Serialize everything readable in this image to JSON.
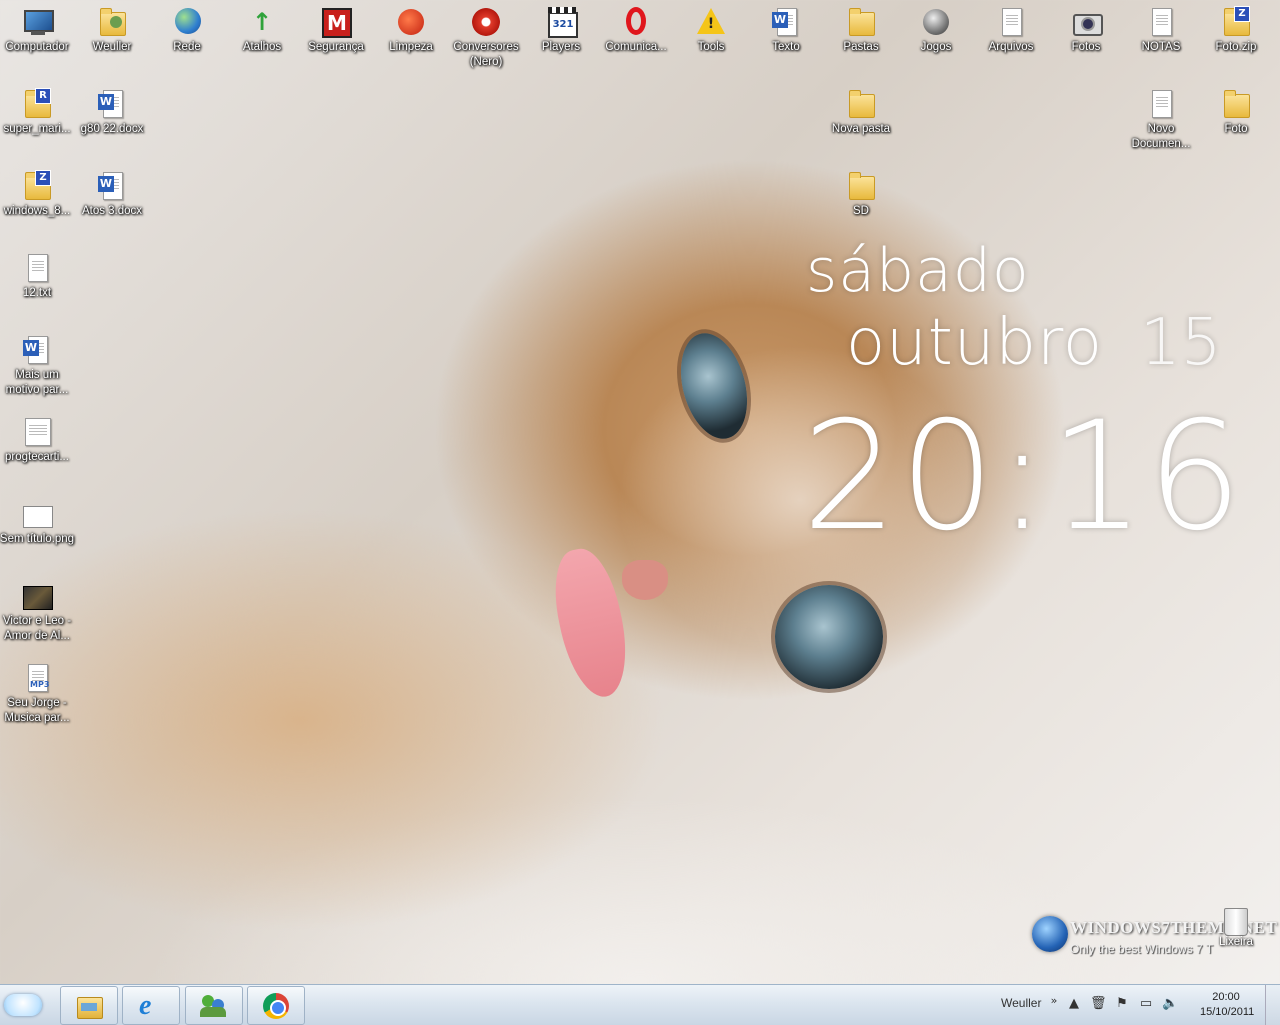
{
  "desktop": {
    "top_row": [
      {
        "label": "Computador",
        "icon": "computer-icon"
      },
      {
        "label": "Weuller",
        "icon": "user-folder-icon"
      },
      {
        "label": "Rede",
        "icon": "network-icon"
      },
      {
        "label": "Atalhos",
        "icon": "green-arrow-icon"
      },
      {
        "label": "Segurança",
        "icon": "malwarebytes-icon"
      },
      {
        "label": "Limpeza",
        "icon": "ccleaner-icon"
      },
      {
        "label": "Conversores (Nero)",
        "icon": "nero-icon"
      },
      {
        "label": "Players",
        "icon": "clapperboard-icon"
      },
      {
        "label": "Comunica...",
        "icon": "opera-icon"
      },
      {
        "label": "Tools",
        "icon": "warning-icon"
      },
      {
        "label": "Texto",
        "icon": "word-icon"
      },
      {
        "label": "Pastas",
        "icon": "folder-icon"
      },
      {
        "label": "Jogos",
        "icon": "games-icon"
      },
      {
        "label": "Arquivos",
        "icon": "file-icon"
      },
      {
        "label": "Fotos",
        "icon": "camera-icon"
      },
      {
        "label": "NOTAS",
        "icon": "notes-icon"
      },
      {
        "label": "Foto.zip",
        "icon": "zip-folder-icon"
      }
    ],
    "left_column": [
      {
        "label": "super_mari...",
        "icon": "rar-folder-icon"
      },
      {
        "label": "g80 22.docx",
        "icon": "word-document-icon"
      },
      {
        "label": "windows_8...",
        "icon": "zip-folder-icon"
      },
      {
        "label": "Atos 3.docx",
        "icon": "word-document-icon"
      },
      {
        "label": "12.txt",
        "icon": "text-file-icon"
      },
      {
        "label": "Mais um motivo par...",
        "icon": "word-document-icon"
      },
      {
        "label": "progtecarti...",
        "icon": "document-icon"
      },
      {
        "label": "Sem título.png",
        "icon": "image-file-icon"
      },
      {
        "label": "Victor e Leo - Amor de Al...",
        "icon": "video-thumbnail-icon"
      },
      {
        "label": "Seu Jorge - Musica par...",
        "icon": "mp3-file-icon"
      }
    ],
    "middle_items": [
      {
        "label": "Nova pasta",
        "icon": "folder-icon"
      },
      {
        "label": "SD",
        "icon": "folder-icon"
      }
    ],
    "right_items": [
      {
        "label": "Novo Documen...",
        "icon": "text-file-icon"
      },
      {
        "label": "Foto",
        "icon": "folder-icon"
      }
    ],
    "recycle_bin": {
      "label": "Lixeira",
      "icon": "recycle-bin-icon"
    }
  },
  "clock_gadget": {
    "day": "sábado",
    "month": "outubro",
    "date": "15",
    "time": "20:16"
  },
  "watermark": {
    "title": "WINDOWS7THEME.NET",
    "subtitle": "Only the best Windows 7 T"
  },
  "taskbar": {
    "pinned": [
      {
        "name": "windows-explorer",
        "icon": "folder-icon"
      },
      {
        "name": "internet-explorer",
        "icon": "ie-icon"
      },
      {
        "name": "messenger",
        "icon": "messenger-icon"
      },
      {
        "name": "chrome",
        "icon": "chrome-icon"
      }
    ],
    "user_label": "Weuller",
    "tray_chevron": "»",
    "clock_time": "20:00",
    "clock_date": "15/10/2011"
  }
}
